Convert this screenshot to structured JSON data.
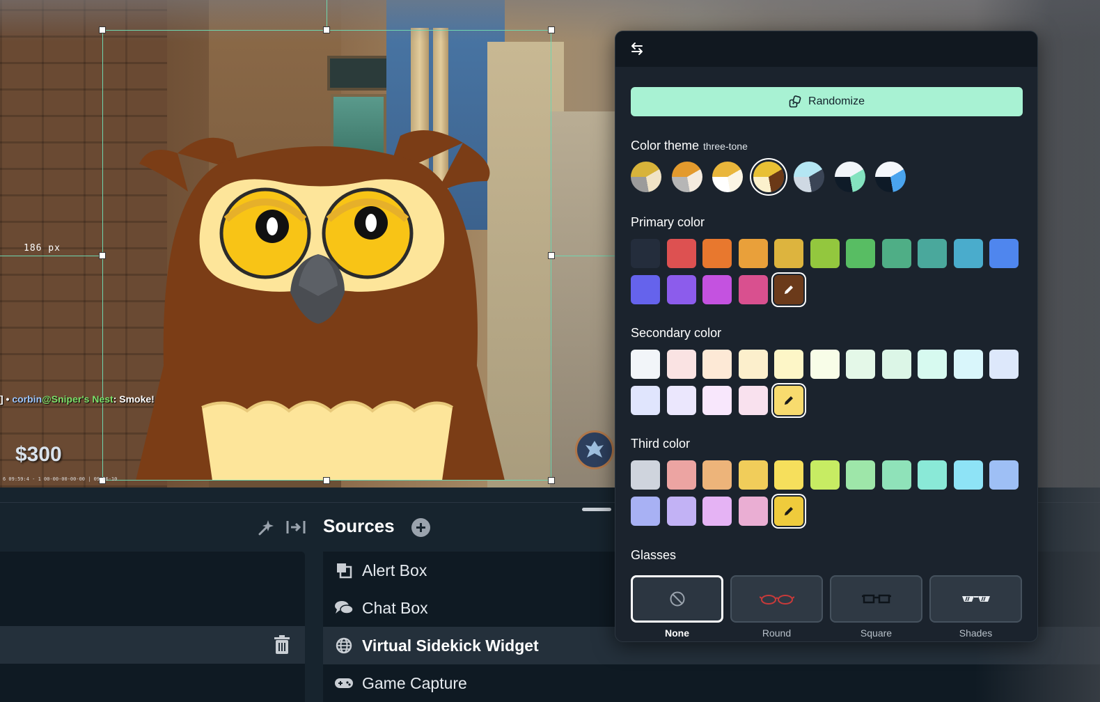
{
  "scene": {
    "measure_label": "186 px",
    "chat": {
      "prefix": "] • ",
      "user": "corbin",
      "at": "@",
      "place": "Sniper's Nest",
      "message": ": Smoke!"
    },
    "money": "$300",
    "debug_text": "6 09:59:4 - 1 00-00-00-00-00 | 09-06-10"
  },
  "panel": {
    "randomize_label": "Randomize",
    "color_theme": {
      "title": "Color theme",
      "subtitle": "three-tone",
      "selected_index": 3,
      "themes": [
        [
          "#d8b33a",
          "#f0e3c6",
          "#9b9b9b"
        ],
        [
          "#e39a2d",
          "#f4ebdf",
          "#b6b6b6"
        ],
        [
          "#e9b63b",
          "#fbf5e4",
          "#ffffff"
        ],
        [
          "#e8c034",
          "#6b3917",
          "#fbf1cc"
        ],
        [
          "#b4e6f3",
          "#3b4556",
          "#cfd9e3"
        ],
        [
          "#f1f5f9",
          "#84e3bf",
          "#0f1b28"
        ],
        [
          "#f4f7fb",
          "#4aa4ee",
          "#0e1a27"
        ]
      ]
    },
    "primary": {
      "title": "Primary color",
      "swatches": [
        "#242d3c",
        "#dd5151",
        "#e8782e",
        "#e9a03a",
        "#ddb43e",
        "#93c73e",
        "#58bd63",
        "#4fae86",
        "#4aa89c",
        "#4aaccc",
        "#4f86ee",
        "#6563ec",
        "#8c5cec",
        "#c452e0",
        "#d9508f"
      ],
      "custom_color": "#6b3a1a"
    },
    "secondary": {
      "title": "Secondary color",
      "swatches": [
        "#f2f5f9",
        "#fae3e3",
        "#fde9d6",
        "#fcefcc",
        "#fdf6c7",
        "#f8fde8",
        "#e4f8e8",
        "#dcf6e7",
        "#d7faf0",
        "#d9f6fb",
        "#dde8fb",
        "#e0e5fd",
        "#ebe7fd",
        "#f8e7fc",
        "#f9e1ee"
      ],
      "custom_color": "#f8db6e"
    },
    "third": {
      "title": "Third color",
      "swatches": [
        "#cfd4dd",
        "#eca4a2",
        "#edb47a",
        "#f1cd5a",
        "#f6df5c",
        "#c7ec63",
        "#9ee6a9",
        "#8fe2b9",
        "#8ae9d7",
        "#8ee3f6",
        "#9ebff5",
        "#a8b1f4",
        "#c2b2f5",
        "#e5b3f4",
        "#eaaed3"
      ],
      "custom_color": "#efcb3c"
    },
    "glasses": {
      "title": "Glasses",
      "options": [
        "None",
        "Round",
        "Square",
        "Shades"
      ],
      "selected": "None"
    }
  },
  "sources": {
    "title": "Sources",
    "items": [
      "Alert Box",
      "Chat Box",
      "Virtual Sidekick Widget",
      "Game Capture"
    ],
    "selected_index": 2
  },
  "colors": {
    "accent": "#a8f2d3",
    "panel_bg": "#1b232d",
    "guide": "#6fd7b0",
    "owl_body": "#7b3d16",
    "owl_face": "#fde59a",
    "owl_eye": "#f8c416"
  }
}
